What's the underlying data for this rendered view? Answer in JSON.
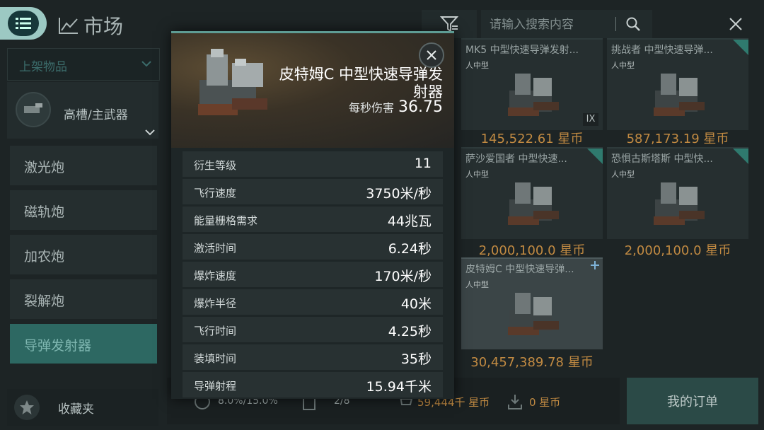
{
  "header": {
    "title": "市场",
    "search_placeholder": "请输入搜索内容"
  },
  "sidebar": {
    "dropdown_label": "上架物品",
    "category_label": "高槽/主武器",
    "items": [
      {
        "label": "激光炮",
        "active": false
      },
      {
        "label": "磁轨炮",
        "active": false
      },
      {
        "label": "加农炮",
        "active": false
      },
      {
        "label": "裂解炮",
        "active": false
      },
      {
        "label": "导弹发射器",
        "active": true
      }
    ],
    "favorites_label": "收藏夹"
  },
  "market": {
    "cards": [
      {
        "name": "MK5 中型快速导弹发射...",
        "tag": "人中型",
        "price": "145,522.61 星币",
        "badge": "IX"
      },
      {
        "name": "挑战者 中型快速导弹...",
        "tag": "人中型",
        "price": "587,173.19 星币",
        "badge": ""
      },
      {
        "name": "萨沙爱国者 中型快速...",
        "tag": "人中型",
        "price": "2,000,100.0 星币",
        "badge": ""
      },
      {
        "name": "恐惧古斯塔斯 中型快...",
        "tag": "人中型",
        "price": "2,000,100.0 星币",
        "badge": ""
      },
      {
        "name": "皮特姆C 中型快速导弹...",
        "tag": "人中型",
        "price": "30,457,389.78 星币",
        "badge": ""
      }
    ]
  },
  "bottom_bar": {
    "tax": "8.0%/15.0%",
    "orders": "2/8",
    "buy_total": "59,444千 星币",
    "sell_total": "0 星币",
    "my_orders_label": "我的订单"
  },
  "popup": {
    "title": "皮特姆C 中型快速导弹发射器",
    "dps_label": "每秒伤害",
    "dps_value": "36.75",
    "stats": [
      {
        "key": "衍生等级",
        "value": "11"
      },
      {
        "key": "飞行速度",
        "value": "3750米/秒"
      },
      {
        "key": "能量栅格需求",
        "value": "44兆瓦"
      },
      {
        "key": "激活时间",
        "value": "6.24秒"
      },
      {
        "key": "爆炸速度",
        "value": "170米/秒"
      },
      {
        "key": "爆炸半径",
        "value": "40米"
      },
      {
        "key": "飞行时间",
        "value": "4.25秒"
      },
      {
        "key": "装填时间",
        "value": "35秒"
      },
      {
        "key": "导弹射程",
        "value": "15.94千米"
      }
    ]
  },
  "colors": {
    "accent": "#2d6862",
    "price_gold": "#c18a42",
    "background": "#1d2425"
  },
  "icons": [
    "menu-icon",
    "chart-icon",
    "filter-icon",
    "search-icon",
    "close-icon",
    "chevron-down-icon",
    "star-icon",
    "launcher-icon"
  ]
}
